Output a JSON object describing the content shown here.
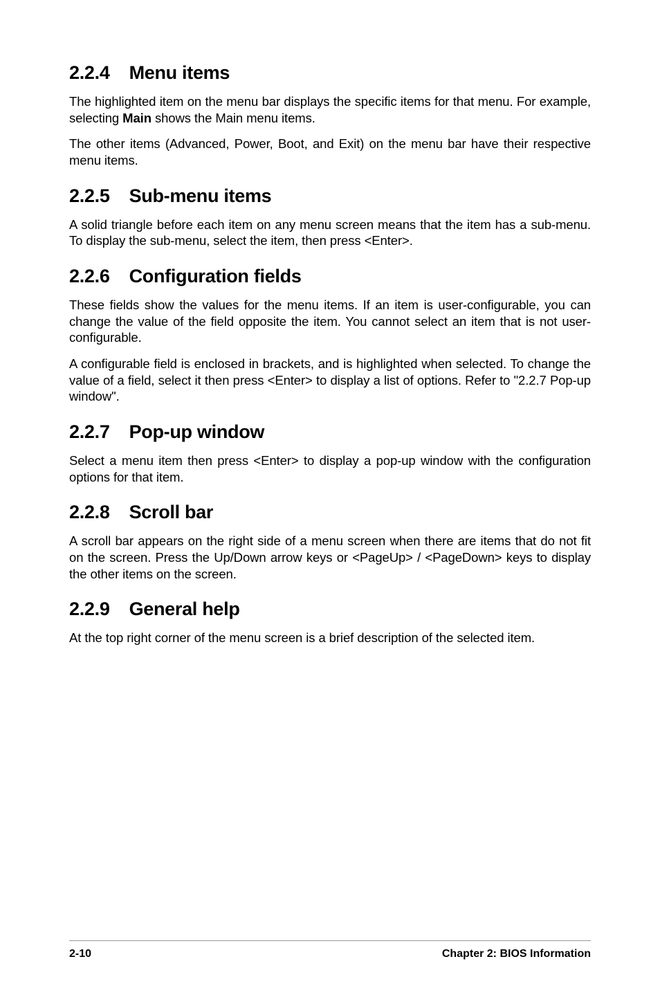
{
  "sections": {
    "s224": {
      "num": "2.2.4",
      "title": "Menu items",
      "p1_a": "The highlighted item on the menu bar displays the specific items for that menu. For example, selecting ",
      "p1_bold": "Main",
      "p1_b": " shows the Main menu items.",
      "p2": "The other items (Advanced, Power, Boot, and Exit) on the menu bar have their respective menu items."
    },
    "s225": {
      "num": "2.2.5",
      "title": "Sub-menu items",
      "p1": "A solid triangle before each item on any menu screen means that the item has a sub-menu. To display the sub-menu, select the item, then press <Enter>."
    },
    "s226": {
      "num": "2.2.6",
      "title": "Configuration fields",
      "p1": "These fields show the values for the menu items. If an item is user-configurable, you can change the value of the field opposite the item. You cannot select an item that is not user-configurable.",
      "p2": "A configurable field is enclosed in brackets, and is highlighted when selected. To change the value of a field, select it then press <Enter> to display a list of options. Refer to \"2.2.7 Pop-up window\"."
    },
    "s227": {
      "num": "2.2.7",
      "title": "Pop-up window",
      "p1": "Select a menu item then press <Enter> to display a pop-up window with the configuration options for that item."
    },
    "s228": {
      "num": "2.2.8",
      "title": "Scroll bar",
      "p1": "A scroll bar appears on the right side of a menu screen when there are items that do not fit on the screen. Press the Up/Down arrow keys or <PageUp> / <PageDown> keys to display the other items on the screen."
    },
    "s229": {
      "num": "2.2.9",
      "title": "General help",
      "p1": "At the top right corner of the menu screen is a brief description of the selected item."
    }
  },
  "footer": {
    "page": "2-10",
    "chapter": "Chapter 2: BIOS Information"
  }
}
